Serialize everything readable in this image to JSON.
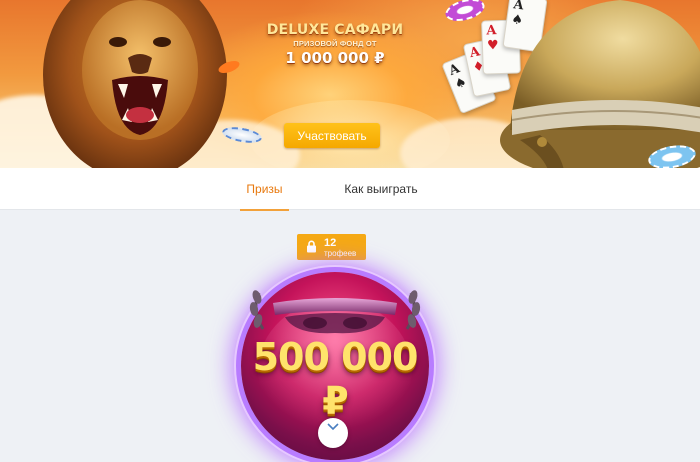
{
  "banner": {
    "title": "DELUXE САФАРИ",
    "prize_fund_label": "ПРИЗОВОЙ ФОНД ОТ",
    "prize_fund_amount": "1 000 000 ₽",
    "participate_label": "Участвовать"
  },
  "tabs": [
    {
      "label": "Призы",
      "active": true
    },
    {
      "label": "Как выиграть",
      "active": false
    }
  ],
  "prize": {
    "trophies_count": "12",
    "trophies_label": "трофеев",
    "amount": "500 000 ₽"
  },
  "colors": {
    "accent": "#f5a914",
    "active_tab": "#e8790e",
    "button": "#ffc21a"
  },
  "icons": [
    "lock-icon",
    "chevron-down-icon"
  ]
}
